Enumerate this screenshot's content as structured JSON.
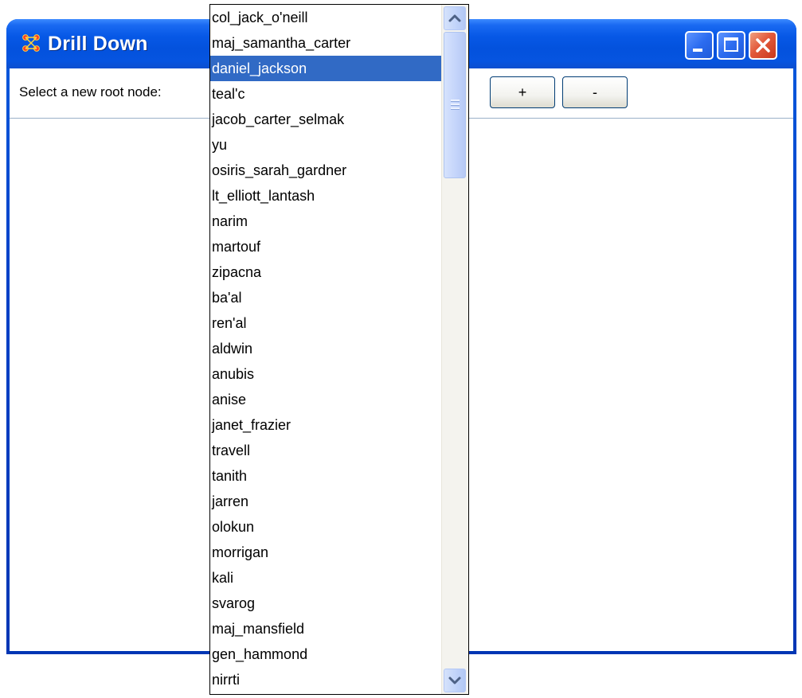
{
  "window": {
    "title": "Drill Down",
    "colors": {
      "titlebar": "#0654e0",
      "close": "#e2593b",
      "selection": "#316ac5"
    }
  },
  "toolbar": {
    "label": "Select a new root node:",
    "plus_label": "+",
    "minus_label": "-"
  },
  "dropdown": {
    "selected": "daniel_jackson",
    "items": [
      "col_jack_o'neill",
      "maj_samantha_carter",
      "daniel_jackson",
      "teal'c",
      "jacob_carter_selmak",
      "yu",
      "osiris_sarah_gardner",
      "lt_elliott_lantash",
      "narim",
      "martouf",
      "zipacna",
      "ba'al",
      "ren'al",
      "aldwin",
      "anubis",
      "anise",
      "janet_frazier",
      "travell",
      "tanith",
      "jarren",
      "olokun",
      "morrigan",
      "kali",
      "svarog",
      "maj_mansfield",
      "gen_hammond",
      "nirrti"
    ]
  }
}
